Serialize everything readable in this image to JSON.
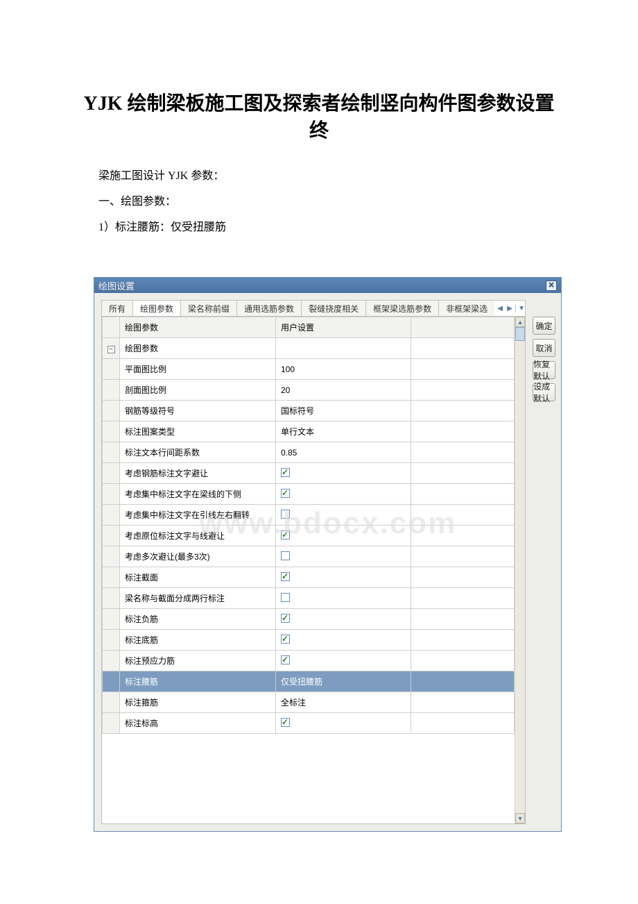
{
  "doc": {
    "title_line1": "YJK 绘制梁板施工图及探索者绘制竖向构件图参数设置",
    "title_line2": "终",
    "para1": "梁施工图设计 YJK 参数：",
    "para2": "一、绘图参数：",
    "para3": "1）标注腰筋：仅受扭腰筋"
  },
  "window": {
    "title": "绘图设置",
    "close_icon": "✕"
  },
  "tabs": {
    "t0": "所有",
    "t1": "绘图参数",
    "t2": "梁名称前缀",
    "t3": "通用选筋参数",
    "t4": "裂缝挠度相关",
    "t5": "框架梁选筋参数",
    "t6": "非框架梁选",
    "nav_prev": "◀",
    "nav_next": "▶",
    "nav_drop": "▼"
  },
  "grid": {
    "header_label": "绘图参数",
    "header_value": "用户设置",
    "tree_row": "绘图参数",
    "tree_symbol": "−",
    "rows": {
      "r0": {
        "label": "平面图比例",
        "value": "100",
        "type": "text"
      },
      "r1": {
        "label": "剖面图比例",
        "value": "20",
        "type": "text"
      },
      "r2": {
        "label": "钢筋等级符号",
        "value": "国标符号",
        "type": "text"
      },
      "r3": {
        "label": "标注图案类型",
        "value": "单行文本",
        "type": "text"
      },
      "r4": {
        "label": "标注文本行间距系数",
        "value": "0.85",
        "type": "text"
      },
      "r5": {
        "label": "考虑钢筋标注文字避让",
        "value": true,
        "type": "check"
      },
      "r6": {
        "label": "考虑集中标注文字在梁线的下侧",
        "value": true,
        "type": "check"
      },
      "r7": {
        "label": "考虑集中标注文字在引线左右翻转",
        "value": false,
        "type": "check"
      },
      "r8": {
        "label": "考虑原位标注文字与线避让",
        "value": true,
        "type": "check"
      },
      "r9": {
        "label": "考虑多次避让(最多3次)",
        "value": false,
        "type": "check"
      },
      "r10": {
        "label": "标注截面",
        "value": true,
        "type": "check"
      },
      "r11": {
        "label": "梁名称与截面分成两行标注",
        "value": false,
        "type": "check"
      },
      "r12": {
        "label": "标注负筋",
        "value": true,
        "type": "check"
      },
      "r13": {
        "label": "标注底筋",
        "value": true,
        "type": "check"
      },
      "r14": {
        "label": "标注预应力筋",
        "value": true,
        "type": "check"
      },
      "r15": {
        "label": "标注腰筋",
        "value": "仅受扭腰筋",
        "type": "text",
        "selected": true
      },
      "r16": {
        "label": "标注箍筋",
        "value": "全标注",
        "type": "text"
      },
      "r17": {
        "label": "标注标高",
        "value": true,
        "type": "check"
      }
    }
  },
  "buttons": {
    "ok": "确定",
    "cancel": "取消",
    "restore": "恢复默认",
    "setdef": "设成默认"
  },
  "watermark": "www.bdocx.com"
}
